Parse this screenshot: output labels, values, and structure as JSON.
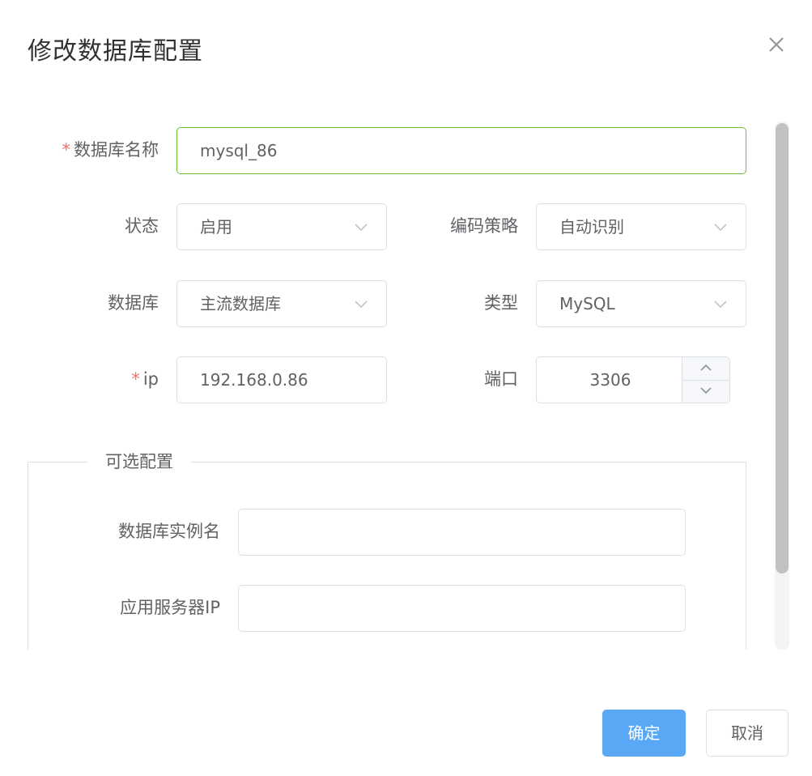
{
  "dialog": {
    "title": "修改数据库配置",
    "close_icon": "close-icon"
  },
  "form": {
    "required_mark": "*",
    "db_name": {
      "label": "数据库名称",
      "value": "mysql_86"
    },
    "status": {
      "label": "状态",
      "value": "启用"
    },
    "encoding": {
      "label": "编码策略",
      "value": "自动识别"
    },
    "database": {
      "label": "数据库",
      "value": "主流数据库"
    },
    "type": {
      "label": "类型",
      "value": "MySQL"
    },
    "ip": {
      "label": "ip",
      "value": "192.168.0.86"
    },
    "port": {
      "label": "端口",
      "value": "3306"
    }
  },
  "optional": {
    "legend": "可选配置",
    "instance_name": {
      "label": "数据库实例名",
      "value": ""
    },
    "app_server_ip": {
      "label": "应用服务器IP",
      "value": ""
    }
  },
  "footer": {
    "confirm_label": "确定",
    "cancel_label": "取消"
  },
  "colors": {
    "required": "#f56c6c",
    "focus_border": "#67c23a",
    "primary": "#5aa7f5",
    "border": "#dcdfe6"
  }
}
